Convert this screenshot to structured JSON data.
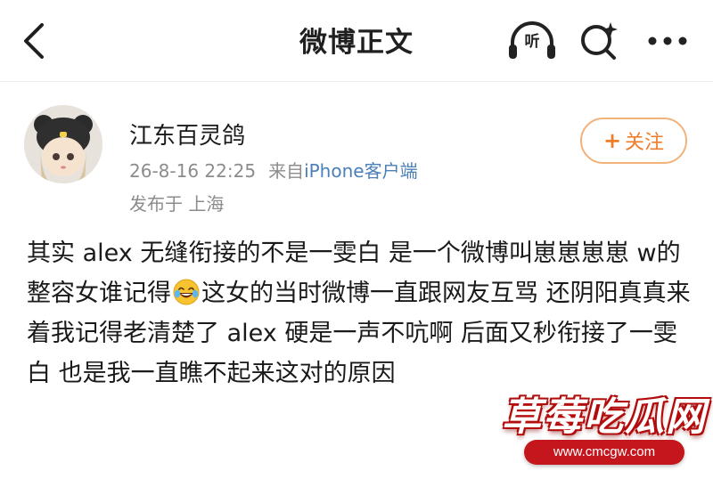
{
  "header": {
    "title": "微博正文",
    "listen_label": "听"
  },
  "author": {
    "name": "江东百灵鸽",
    "timestamp": "26-8-16 22:25",
    "source_prefix": "来自",
    "source": "iPhone客户端",
    "location": "发布于 上海",
    "follow_label": "关注"
  },
  "post": {
    "text_before_emoji": "其实 alex 无缝衔接的不是一雯白 是一个微博叫崽崽崽崽 w的整容女谁记得",
    "emoji": "laughing-crying-emoji",
    "text_after_emoji": "这女的当时微博一直跟网友互骂 还阴阳真真来着我记得老清楚了 alex 硬是一声不吭啊 后面又秒衔接了一雯白 也是我一直瞧不起来这对的原因"
  },
  "watermark": {
    "title": "草莓吃瓜网",
    "url": "www.cmcgw.com"
  },
  "colors": {
    "accent_orange": "#ee7d2b",
    "link_blue": "#4a7fb8",
    "meta_gray": "#8c8c8c",
    "watermark_red": "#c4161c"
  }
}
